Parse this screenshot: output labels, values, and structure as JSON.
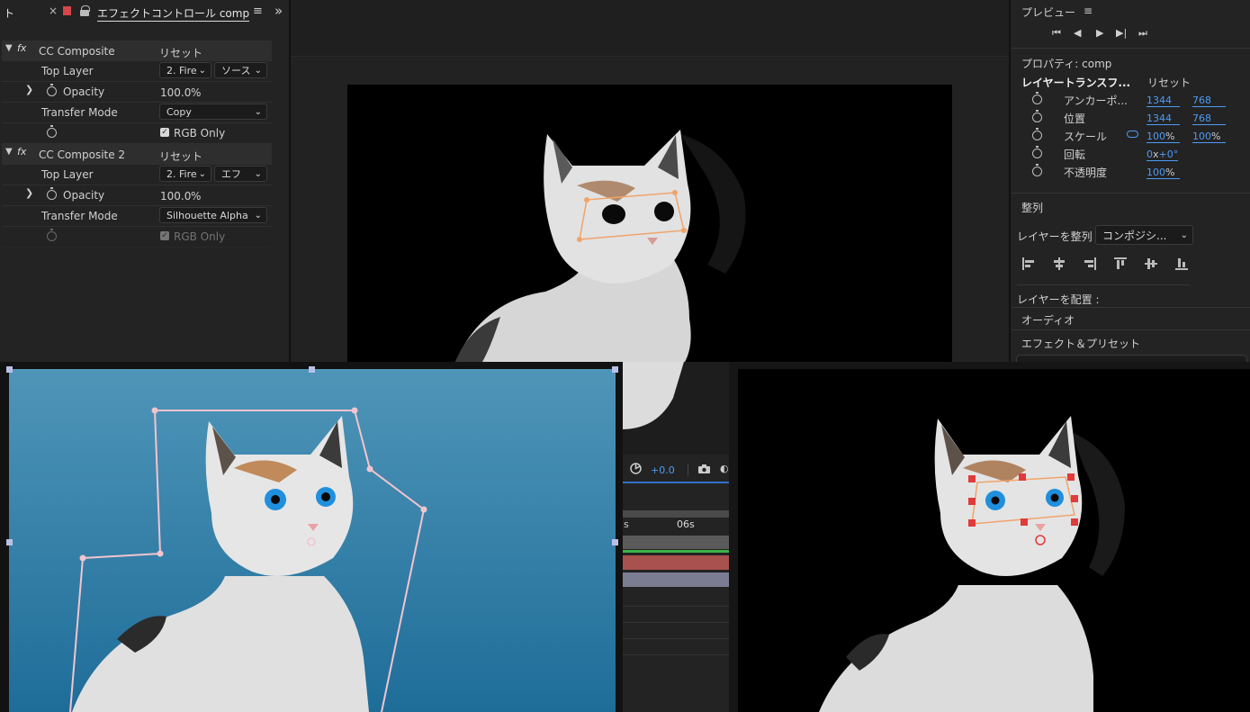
{
  "effects_panel": {
    "tab_prefix": "ト",
    "tab_close": "×",
    "tab_title": "エフェクトコントロール comp",
    "menu_glyph": "≡",
    "overflow_glyph": "»",
    "effects": [
      {
        "name": "CC Composite",
        "reset": "リセット",
        "top_layer_label": "Top Layer",
        "top_layer_value": "2. Fire",
        "top_layer_source": "ソース",
        "opacity_label": "Opacity",
        "opacity_value": "100.0",
        "opacity_unit": "%",
        "transfer_label": "Transfer Mode",
        "transfer_value": "Copy",
        "rgb_only": "RGB Only"
      },
      {
        "name": "CC Composite 2",
        "reset": "リセット",
        "top_layer_label": "Top Layer",
        "top_layer_value": "2. Fire",
        "top_layer_source": "エフ",
        "opacity_label": "Opacity",
        "opacity_value": "100.0",
        "opacity_unit": "%",
        "transfer_label": "Transfer Mode",
        "transfer_value": "Silhouette Alpha",
        "rgb_only": "RGB Only"
      }
    ]
  },
  "preview_panel": {
    "title": "プレビュー",
    "menu_glyph": "≡",
    "controls": [
      "⏮",
      "◀",
      "▶",
      "▶|",
      "⏭"
    ]
  },
  "properties_panel": {
    "title": "プロパティ: comp",
    "section": "レイヤートランスフ...",
    "reset": "リセット",
    "props": [
      {
        "label": "アンカーポ...",
        "v1": "1344",
        "v2": "768"
      },
      {
        "label": "位置",
        "v1": "1344",
        "v2": "768"
      },
      {
        "label": "スケール",
        "v1": "100",
        "v1_unit": "%",
        "v2": "100",
        "v2_unit": "%"
      },
      {
        "label": "回転",
        "v1": "0",
        "v1_unit": "x",
        "v2": "+0°"
      },
      {
        "label": "不透明度",
        "v1": "100",
        "v1_unit": "%"
      }
    ]
  },
  "align_panel": {
    "title": "整列",
    "align_to_label": "レイヤーを整列",
    "align_to_value": "コンポジシ...",
    "distribute_label": "レイヤーを配置 :"
  },
  "audio_panel": {
    "title": "オーディオ"
  },
  "effects_presets_panel": {
    "title": "エフェクト＆プリセット"
  },
  "timeline": {
    "exposure_value": "+0.0",
    "time_left": "s",
    "time_marker": "06s"
  },
  "colors": {
    "accent_blue": "#4d9bf5",
    "panel_bg": "#232323",
    "sky_blue": "#3f84a9"
  }
}
